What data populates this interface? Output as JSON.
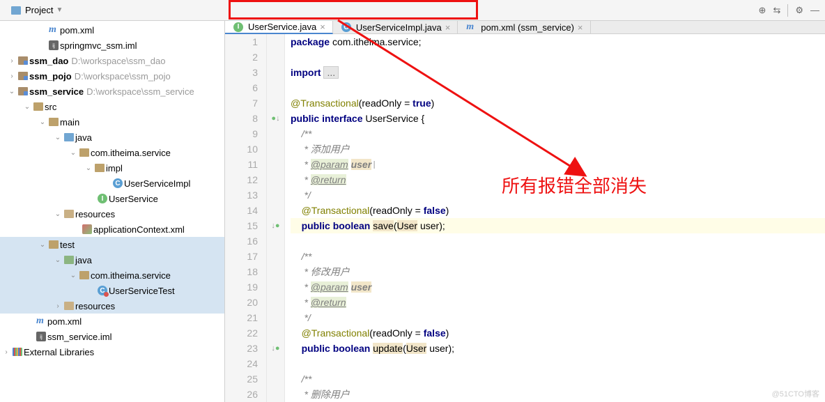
{
  "toolbar": {
    "project_label": "Project"
  },
  "tree": {
    "pom1": "pom.xml",
    "springmvc_iml": "springmvc_ssm.iml",
    "ssm_dao": {
      "name": "ssm_dao",
      "path": "D:\\workspace\\ssm_dao"
    },
    "ssm_pojo": {
      "name": "ssm_pojo",
      "path": "D:\\workspace\\ssm_pojo"
    },
    "ssm_service": {
      "name": "ssm_service",
      "path": "D:\\workspace\\ssm_service"
    },
    "src": "src",
    "main": "main",
    "java": "java",
    "pkg": "com.itheima.service",
    "impl": "impl",
    "userServiceImpl": "UserServiceImpl",
    "userService": "UserService",
    "resources": "resources",
    "appctx": "applicationContext.xml",
    "test": "test",
    "testjava": "java",
    "testpkg": "com.itheima.service",
    "userServiceTest": "UserServiceTest",
    "testresources": "resources",
    "pom2": "pom.xml",
    "ssm_service_iml": "ssm_service.iml",
    "ext_libs": "External Libraries"
  },
  "tabs": {
    "t1": "UserService.java",
    "t2": "UserServiceImpl.java",
    "t3": "pom.xml (ssm_service)"
  },
  "code": {
    "line_numbers": [
      "1",
      "2",
      "3",
      "6",
      "7",
      "8",
      "9",
      "10",
      "11",
      "12",
      "13",
      "14",
      "15",
      "16",
      "17",
      "18",
      "19",
      "20",
      "21",
      "22",
      "23",
      "24",
      "25",
      "26"
    ],
    "l1": {
      "package": "package",
      "pkg": "com.itheima.service;"
    },
    "l3": {
      "import": "import",
      "ellipsis": "..."
    },
    "l7": {
      "ann": "@Transactional",
      "args": "(readOnly = ",
      "true": "true",
      "close": ")"
    },
    "l8": {
      "public": "public",
      "interface": "interface",
      "name": "UserService",
      "brace": "{"
    },
    "l9": "/**",
    "l10": " * 添加用户",
    "l11": {
      "star": " * ",
      "tag": "@param",
      "param": "user"
    },
    "l12": {
      "star": " * ",
      "tag": "@return"
    },
    "l13": " */",
    "l14": {
      "ann": "@Transactional",
      "args": "(readOnly = ",
      "false": "false",
      "close": ")"
    },
    "l15": {
      "public": "public",
      "boolean": "boolean",
      "method": "save",
      "open": "(",
      "type": "User",
      "param": "user",
      "close": ");"
    },
    "l17": "/**",
    "l18": " * 修改用户",
    "l19": {
      "star": " * ",
      "tag": "@param",
      "param": "user"
    },
    "l20": {
      "star": " * ",
      "tag": "@return"
    },
    "l21": " */",
    "l22": {
      "ann": "@Transactional",
      "args": "(readOnly = ",
      "false": "false",
      "close": ")"
    },
    "l23": {
      "public": "public",
      "boolean": "boolean",
      "method": "update",
      "open": "(",
      "type": "User",
      "param": "user",
      "close": ");"
    },
    "l25": "/**",
    "l26": " * 删除用户"
  },
  "annotation": {
    "text": "所有报错全部消失"
  },
  "watermark": "@51CTO博客"
}
